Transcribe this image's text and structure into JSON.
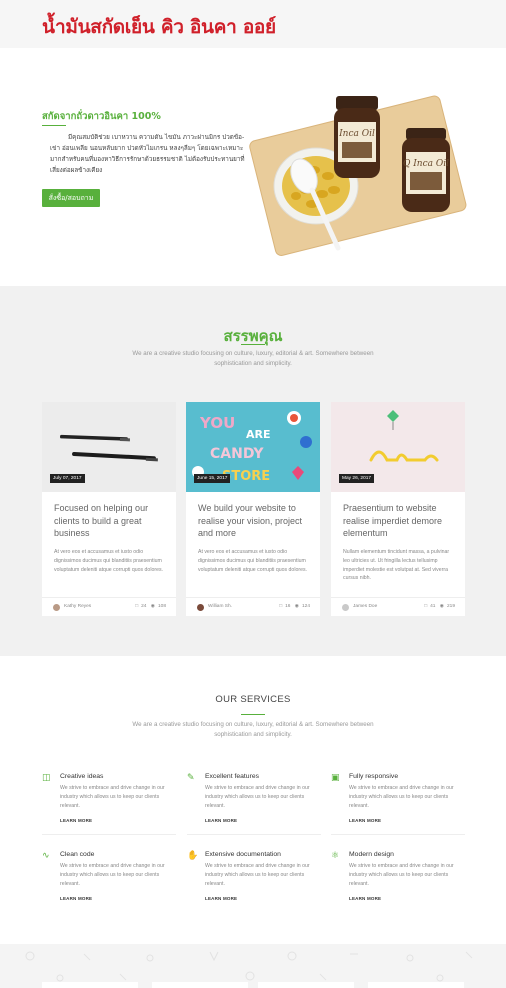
{
  "header": {
    "title": "น้ำมันสกัดเย็น คิว อินคา ออย์"
  },
  "hero": {
    "heading": "สกัดจากถั่วดาวอินคา 100%",
    "text": "มีคุณสมบัติช่วย เบาหวาน ความดัน ไขมัน ภาวะผ่านมิกร ปวดข้อ-เข่า อ่อนเพลีย นอนหลับยาก ปวดหัวไมเกรน หลงๆลืมๆ โดยเฉพาะเหมาะมากสำหรับคนที่มองหาวิธีการรักษาด้วยธรรมชาติ ไม่ต้องรับประทานยาที่เสี่ยงต่อผลข้างเคียง",
    "button_label": "สั่งซื้อ/สอบถาม"
  },
  "features": {
    "title": "สรรพคุณ",
    "subtitle": "We are a creative studio focusing on culture, luxury, editorial & art. Somewhere between sophistication and simplicity.",
    "cards": [
      {
        "date": "July 07, 2017",
        "title": "Focused on helping our clients to build a great business",
        "text": "At vero eos et accusamus et iusto odio dignissimos ducimus qui blanditiis praesentium voluptatum deleniti atque corrupti quos dolores.",
        "author": "Kathy Reyes",
        "comments": "24",
        "views": "108"
      },
      {
        "date": "June 15, 2017",
        "title": "We build your website to realise your vision, project and more",
        "text": "At vero eos et accusamus et iusto odio dignissimos ducimus qui blanditiis praesentium voluptatum deleniti atque corrupti quos dolores.",
        "author": "William Sh.",
        "comments": "16",
        "views": "124"
      },
      {
        "date": "May 26, 2017",
        "title": "Praesentium to website realise imperdiet demore elementum",
        "text": "Nullam elementum tincidunt massa, a pulvinar leo ultricies ut. Ut fringilla lectus tellusimp imperdiet molestie est volutpat at. Sed viverra cursus nibh.",
        "author": "James Doe",
        "comments": "41",
        "views": "219"
      }
    ]
  },
  "services": {
    "title": "OUR SERVICES",
    "subtitle": "We are a creative studio focusing on culture, luxury, editorial & art. Somewhere between sophistication and simplicity.",
    "items": [
      {
        "icon": "folder-icon",
        "name": "Creative ideas",
        "desc": "We strive to embrace and drive change in our industry which allows us to keep our clients relevant.",
        "link": "LEARN MORE"
      },
      {
        "icon": "pencil-icon",
        "name": "Excellent features",
        "desc": "We strive to embrace and drive change in our industry which allows us to keep our clients relevant.",
        "link": "LEARN MORE"
      },
      {
        "icon": "responsive-icon",
        "name": "Fully responsive",
        "desc": "We strive to embrace and drive change in our industry which allows us to keep our clients relevant.",
        "link": "LEARN MORE"
      },
      {
        "icon": "pulse-icon",
        "name": "Clean code",
        "desc": "We strive to embrace and drive change in our industry which allows us to keep our clients relevant.",
        "link": "LEARN MORE"
      },
      {
        "icon": "hand-icon",
        "name": "Extensive documentation",
        "desc": "We strive to embrace and drive change in our industry which allows us to keep our clients relevant.",
        "link": "LEARN MORE"
      },
      {
        "icon": "design-icon",
        "name": "Modern design",
        "desc": "We strive to embrace and drive change in our industry which allows us to keep our clients relevant.",
        "link": "LEARN MORE"
      }
    ]
  },
  "colors": {
    "accent": "#58b03c",
    "brand_red": "#d0202a"
  }
}
